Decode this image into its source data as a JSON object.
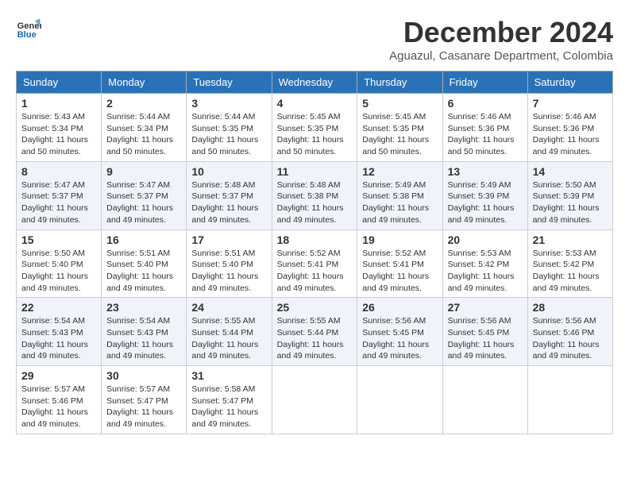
{
  "logo": {
    "line1": "General",
    "line2": "Blue"
  },
  "title": "December 2024",
  "subtitle": "Aguazul, Casanare Department, Colombia",
  "weekdays": [
    "Sunday",
    "Monday",
    "Tuesday",
    "Wednesday",
    "Thursday",
    "Friday",
    "Saturday"
  ],
  "weeks": [
    [
      {
        "day": "1",
        "sunrise": "5:43 AM",
        "sunset": "5:34 PM",
        "daylight": "11 hours and 50 minutes."
      },
      {
        "day": "2",
        "sunrise": "5:44 AM",
        "sunset": "5:34 PM",
        "daylight": "11 hours and 50 minutes."
      },
      {
        "day": "3",
        "sunrise": "5:44 AM",
        "sunset": "5:35 PM",
        "daylight": "11 hours and 50 minutes."
      },
      {
        "day": "4",
        "sunrise": "5:45 AM",
        "sunset": "5:35 PM",
        "daylight": "11 hours and 50 minutes."
      },
      {
        "day": "5",
        "sunrise": "5:45 AM",
        "sunset": "5:35 PM",
        "daylight": "11 hours and 50 minutes."
      },
      {
        "day": "6",
        "sunrise": "5:46 AM",
        "sunset": "5:36 PM",
        "daylight": "11 hours and 50 minutes."
      },
      {
        "day": "7",
        "sunrise": "5:46 AM",
        "sunset": "5:36 PM",
        "daylight": "11 hours and 49 minutes."
      }
    ],
    [
      {
        "day": "8",
        "sunrise": "5:47 AM",
        "sunset": "5:37 PM",
        "daylight": "11 hours and 49 minutes."
      },
      {
        "day": "9",
        "sunrise": "5:47 AM",
        "sunset": "5:37 PM",
        "daylight": "11 hours and 49 minutes."
      },
      {
        "day": "10",
        "sunrise": "5:48 AM",
        "sunset": "5:37 PM",
        "daylight": "11 hours and 49 minutes."
      },
      {
        "day": "11",
        "sunrise": "5:48 AM",
        "sunset": "5:38 PM",
        "daylight": "11 hours and 49 minutes."
      },
      {
        "day": "12",
        "sunrise": "5:49 AM",
        "sunset": "5:38 PM",
        "daylight": "11 hours and 49 minutes."
      },
      {
        "day": "13",
        "sunrise": "5:49 AM",
        "sunset": "5:39 PM",
        "daylight": "11 hours and 49 minutes."
      },
      {
        "day": "14",
        "sunrise": "5:50 AM",
        "sunset": "5:39 PM",
        "daylight": "11 hours and 49 minutes."
      }
    ],
    [
      {
        "day": "15",
        "sunrise": "5:50 AM",
        "sunset": "5:40 PM",
        "daylight": "11 hours and 49 minutes."
      },
      {
        "day": "16",
        "sunrise": "5:51 AM",
        "sunset": "5:40 PM",
        "daylight": "11 hours and 49 minutes."
      },
      {
        "day": "17",
        "sunrise": "5:51 AM",
        "sunset": "5:40 PM",
        "daylight": "11 hours and 49 minutes."
      },
      {
        "day": "18",
        "sunrise": "5:52 AM",
        "sunset": "5:41 PM",
        "daylight": "11 hours and 49 minutes."
      },
      {
        "day": "19",
        "sunrise": "5:52 AM",
        "sunset": "5:41 PM",
        "daylight": "11 hours and 49 minutes."
      },
      {
        "day": "20",
        "sunrise": "5:53 AM",
        "sunset": "5:42 PM",
        "daylight": "11 hours and 49 minutes."
      },
      {
        "day": "21",
        "sunrise": "5:53 AM",
        "sunset": "5:42 PM",
        "daylight": "11 hours and 49 minutes."
      }
    ],
    [
      {
        "day": "22",
        "sunrise": "5:54 AM",
        "sunset": "5:43 PM",
        "daylight": "11 hours and 49 minutes."
      },
      {
        "day": "23",
        "sunrise": "5:54 AM",
        "sunset": "5:43 PM",
        "daylight": "11 hours and 49 minutes."
      },
      {
        "day": "24",
        "sunrise": "5:55 AM",
        "sunset": "5:44 PM",
        "daylight": "11 hours and 49 minutes."
      },
      {
        "day": "25",
        "sunrise": "5:55 AM",
        "sunset": "5:44 PM",
        "daylight": "11 hours and 49 minutes."
      },
      {
        "day": "26",
        "sunrise": "5:56 AM",
        "sunset": "5:45 PM",
        "daylight": "11 hours and 49 minutes."
      },
      {
        "day": "27",
        "sunrise": "5:56 AM",
        "sunset": "5:45 PM",
        "daylight": "11 hours and 49 minutes."
      },
      {
        "day": "28",
        "sunrise": "5:56 AM",
        "sunset": "5:46 PM",
        "daylight": "11 hours and 49 minutes."
      }
    ],
    [
      {
        "day": "29",
        "sunrise": "5:57 AM",
        "sunset": "5:46 PM",
        "daylight": "11 hours and 49 minutes."
      },
      {
        "day": "30",
        "sunrise": "5:57 AM",
        "sunset": "5:47 PM",
        "daylight": "11 hours and 49 minutes."
      },
      {
        "day": "31",
        "sunrise": "5:58 AM",
        "sunset": "5:47 PM",
        "daylight": "11 hours and 49 minutes."
      },
      null,
      null,
      null,
      null
    ]
  ]
}
